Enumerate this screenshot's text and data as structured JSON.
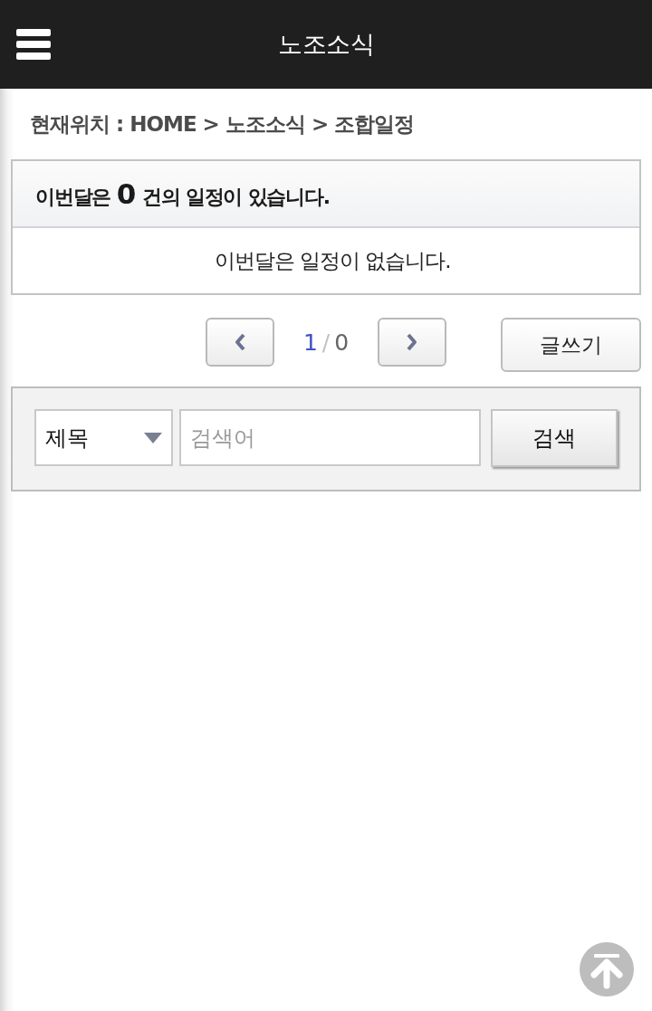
{
  "header": {
    "title": "노조소식"
  },
  "breadcrumb": "현재위치 : HOME > 노조소식 > 조합일정",
  "schedule": {
    "summary": "이번달은 **0** 건의 일정이 있습니다.",
    "empty_message": "이번달은 일정이 없습니다."
  },
  "pager": {
    "current": "1",
    "separator": "/",
    "total": "0"
  },
  "write_button": "글쓰기",
  "search": {
    "field_select": "제목",
    "placeholder": "검색어",
    "button": "검색"
  }
}
